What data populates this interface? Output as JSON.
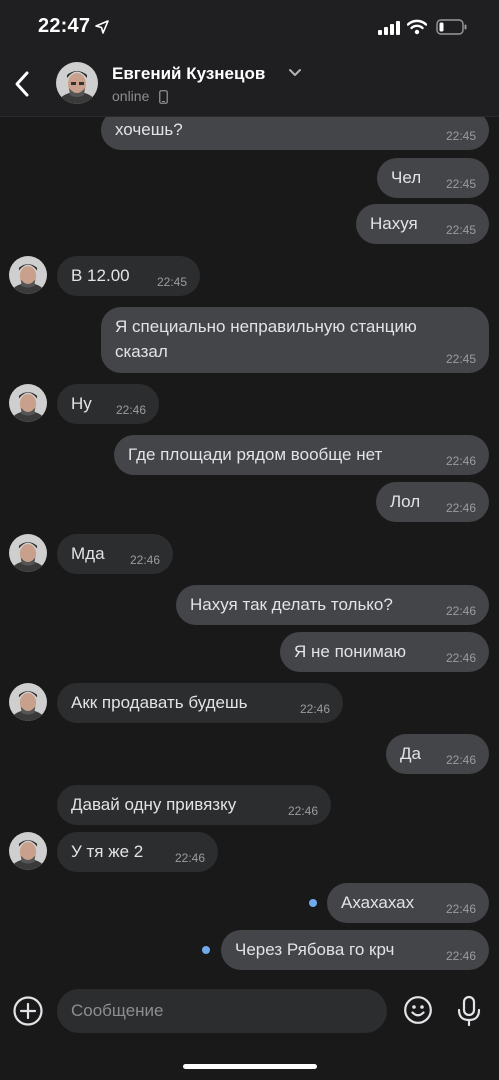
{
  "status_bar": {
    "time": "22:47"
  },
  "header": {
    "contact_name": "Евгений Кузнецов",
    "status": "online"
  },
  "messages": [
    {
      "direction": "out",
      "text": "хочешь?",
      "time": "22:45"
    },
    {
      "direction": "out",
      "text": "Чел",
      "time": "22:45"
    },
    {
      "direction": "out",
      "text": "Нахуя",
      "time": "22:45"
    },
    {
      "direction": "in",
      "text": "В 12.00",
      "time": "22:45",
      "avatar": true
    },
    {
      "direction": "out",
      "text_line1": "Я специально неправильную станцию",
      "text_line2": "сказал",
      "time": "22:45"
    },
    {
      "direction": "in",
      "text": "Ну",
      "time": "22:46",
      "avatar": true
    },
    {
      "direction": "out",
      "text": "Где площади рядом вообще нет",
      "time": "22:46"
    },
    {
      "direction": "out",
      "text": "Лол",
      "time": "22:46"
    },
    {
      "direction": "in",
      "text": "Мда",
      "time": "22:46",
      "avatar": true
    },
    {
      "direction": "out",
      "text": "Нахуя так делать только?",
      "time": "22:46"
    },
    {
      "direction": "out",
      "text": "Я не понимаю",
      "time": "22:46"
    },
    {
      "direction": "in",
      "text": "Акк продавать будешь",
      "time": "22:46",
      "avatar": true
    },
    {
      "direction": "out",
      "text": "Да",
      "time": "22:46"
    },
    {
      "direction": "in",
      "text": "Давай одну привязку",
      "time": "22:46"
    },
    {
      "direction": "in",
      "text": "У тя же 2",
      "time": "22:46",
      "avatar": true
    },
    {
      "direction": "out",
      "text": "Ахахахах",
      "time": "22:46",
      "unread": true
    },
    {
      "direction": "out",
      "text": "Через Рябова го крч",
      "time": "22:46",
      "unread": true
    }
  ],
  "composer": {
    "placeholder": "Сообщение"
  },
  "colors": {
    "background": "#19191a",
    "incoming_bubble": "#2c2d2e",
    "outgoing_bubble": "#444548",
    "unread_dot": "#71aaeb"
  },
  "icons": [
    "location-arrow-icon",
    "signal-icon",
    "wifi-icon",
    "battery-icon",
    "back-icon",
    "chevron-down-icon",
    "phone-icon",
    "attach-plus-icon",
    "sticker-icon",
    "microphone-icon"
  ]
}
